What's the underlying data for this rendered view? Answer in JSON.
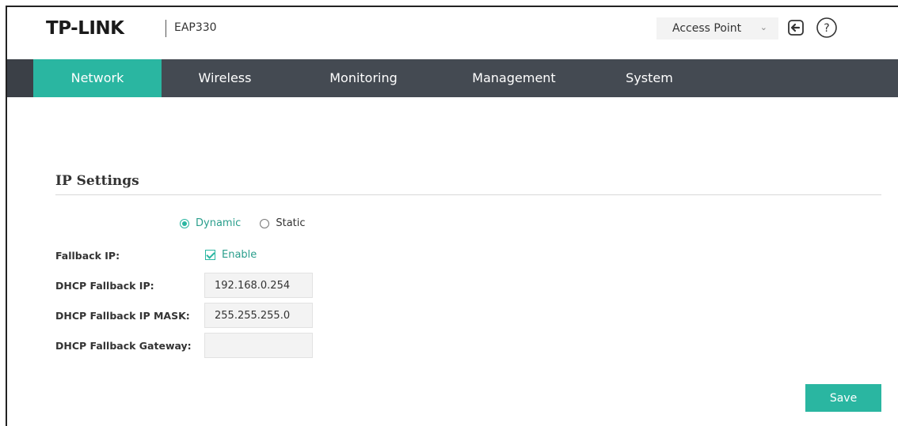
{
  "header": {
    "brand": "TP-LINK",
    "model": "EAP330",
    "mode": {
      "selected": "Access Point"
    }
  },
  "icons": {
    "logout": "logout-icon",
    "help": "help-icon",
    "chevron": "chevron-down-icon"
  },
  "nav": {
    "items": [
      {
        "label": "Network",
        "active": true
      },
      {
        "label": "Wireless",
        "active": false
      },
      {
        "label": "Monitoring",
        "active": false
      },
      {
        "label": "Management",
        "active": false
      },
      {
        "label": "System",
        "active": false
      }
    ]
  },
  "ip_settings": {
    "title": "IP Settings",
    "mode_options": [
      {
        "label": "Dynamic",
        "selected": true
      },
      {
        "label": "Static",
        "selected": false
      }
    ],
    "fallback_ip": {
      "label": "Fallback IP:",
      "option_label": "Enable",
      "checked": true
    },
    "dhcp_fallback_ip": {
      "label": "DHCP Fallback IP:",
      "value": "192.168.0.254"
    },
    "dhcp_fallback_mask": {
      "label": "DHCP Fallback IP MASK:",
      "value": "255.255.255.0"
    },
    "dhcp_fallback_gateway": {
      "label": "DHCP Fallback Gateway:",
      "value": ""
    },
    "save_label": "Save"
  },
  "colors": {
    "accent": "#2ab6a1",
    "nav_bg": "#444a52",
    "text": "#333333"
  }
}
